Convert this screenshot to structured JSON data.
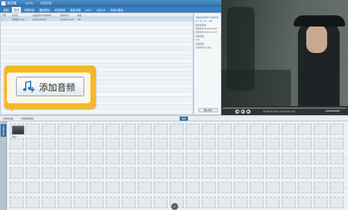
{
  "titlebar": {
    "app_name": "爱剪辑",
    "app_sub": "未命名",
    "hint": "视频剪辑",
    "color": "#2b6ea8"
  },
  "menu": {
    "tabs": [
      "视频",
      "音频",
      "字幕特效",
      "叠加素材",
      "转场特效",
      "画面风格",
      "MTV",
      "卡拉OK",
      "升级与服务"
    ],
    "active_index": 1
  },
  "list": {
    "headers": [
      "序号",
      "文件名",
      "在最终影片中的时间",
      "裁剪时长",
      "音量"
    ],
    "rows": [
      {
        "idx": "1",
        "name": "背景音乐.mp3",
        "time": "00:00:00.000",
        "dur": "00:00:31.120",
        "vol": "100"
      }
    ],
    "empty_rows": 22
  },
  "side": {
    "section1": "音频在最终影片中的时间",
    "v1": "00 : 00 : 00 . 000",
    "section2": "裁剪原音频",
    "v2": "开始时间 00:00:00.000",
    "v3": "结束时间 00:00:31.120",
    "section3": "音频音量",
    "v4": "100",
    "section4": "音频特效",
    "v5": "头尾声音淡入淡出",
    "confirm": "确认修改"
  },
  "controls": {
    "time": "00:00:00.000 / 00:00:31.120"
  },
  "bar": {
    "added_clips": "已添加片段",
    "audio_tab": "添加音频",
    "mode_tab": "已添加的音频",
    "play_button": "播放"
  },
  "timeline": {
    "side_tag": "已添加片段",
    "clip_label": "片段1",
    "rows": 6,
    "cols": 21
  },
  "callout": {
    "button_label": "添加音频",
    "icon": "music-note-plus-icon",
    "accent": "#f6b72a"
  }
}
